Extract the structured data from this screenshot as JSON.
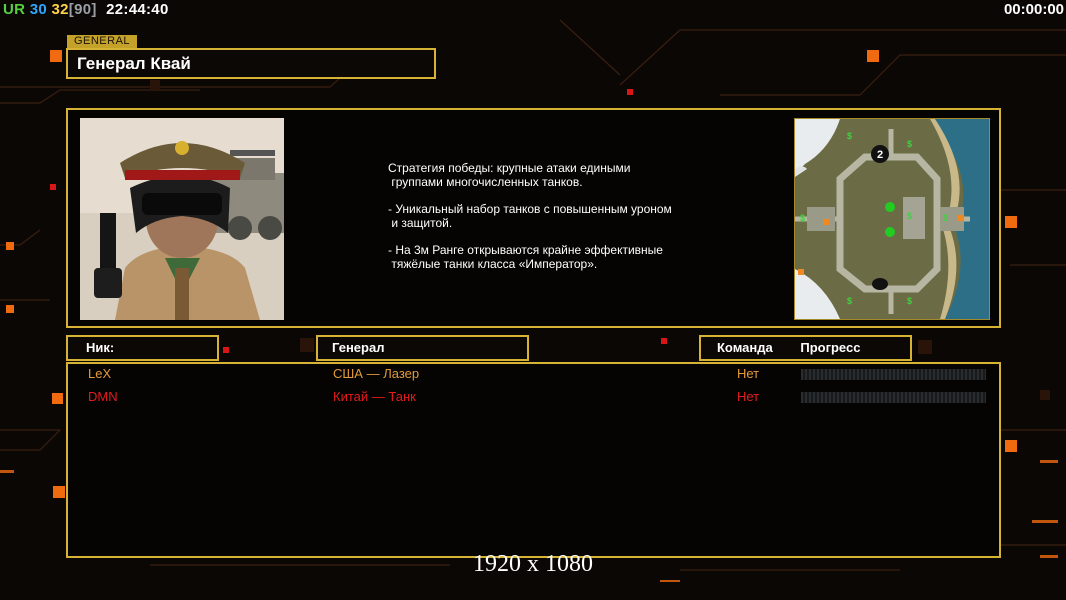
{
  "overlay": {
    "fps_prefix": "UR",
    "fps_a": "30",
    "fps_b": "32",
    "fps_c": "[90]",
    "clock": "22:44:40",
    "timer": "00:00:00"
  },
  "general": {
    "tab_label": "GENERAL",
    "name": "Генерал Квай"
  },
  "description": {
    "p1": "Стратегия победы: крупные атаки едиными\n группами многочисленных танков.",
    "p2": "- Уникальный набор танков с повышенным уроном\n и защитой.",
    "p3": "- На 3м Ранге открываются крайне эффективные\n тяжёлые танки класса «Император»."
  },
  "map": {
    "start_marker_2": "2",
    "cash_marker": "$"
  },
  "headers": {
    "nick": "Ник:",
    "general": "Генерал",
    "team": "Команда",
    "progress": "Прогресс"
  },
  "players": [
    {
      "nick": "LeX",
      "general": "США — Лазер",
      "team": "Нет",
      "color": "#e39a3c",
      "progress": 0
    },
    {
      "nick": "DMN",
      "general": "Китай — Танк",
      "team": "Нет",
      "color": "#e31c1c",
      "progress": 0
    }
  ],
  "colors": {
    "frame": "#d7b335",
    "accent": "#f06a10",
    "background": "#0b0705"
  },
  "footer": {
    "resolution": "1920 x 1080"
  }
}
